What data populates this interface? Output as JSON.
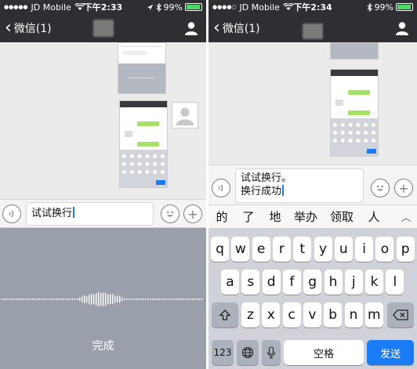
{
  "left": {
    "status": {
      "carrier": "JD Mobile",
      "time": "下午2:33",
      "battery": "99%"
    },
    "nav": {
      "back_label": "微信(1)"
    },
    "input": {
      "text": "试试换行"
    },
    "voice": {
      "done_label": "完成"
    }
  },
  "right": {
    "status": {
      "carrier": "JD Mobile",
      "time": "下午2:34",
      "battery": "99%"
    },
    "nav": {
      "back_label": "微信(1)"
    },
    "input": {
      "line1": "试试换行。",
      "line2": "换行成功"
    },
    "candidates": [
      "的",
      "了",
      "地",
      "举办",
      "领取",
      "人"
    ],
    "keyboard": {
      "row1": [
        "q",
        "w",
        "e",
        "r",
        "t",
        "y",
        "u",
        "i",
        "o",
        "p"
      ],
      "row2": [
        "a",
        "s",
        "d",
        "f",
        "g",
        "h",
        "j",
        "k",
        "l"
      ],
      "row3": [
        "z",
        "x",
        "c",
        "v",
        "b",
        "n",
        "m"
      ],
      "num_label": "123",
      "space_label": "空格",
      "send_label": "发送"
    }
  },
  "colors": {
    "nav_bg": "#2f2f33",
    "send": "#1a7cf5",
    "voice_bg": "#9aa0aa",
    "bubble_green": "#a6e067"
  },
  "icons": [
    "chevron-left-icon",
    "person-icon",
    "voice-icon",
    "emoji-icon",
    "plus-icon",
    "chevron-up-icon",
    "shift-icon",
    "backspace-icon",
    "globe-icon",
    "microphone-icon",
    "wifi-icon",
    "bluetooth-icon",
    "location-icon",
    "battery-icon"
  ]
}
